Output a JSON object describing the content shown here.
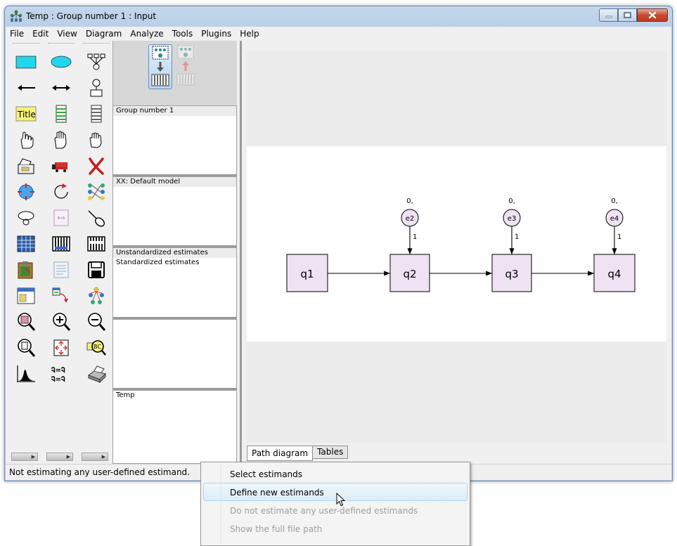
{
  "window": {
    "title": "Temp : Group number 1 : Input"
  },
  "menu": [
    "File",
    "Edit",
    "View",
    "Diagram",
    "Analyze",
    "Tools",
    "Plugins",
    "Help"
  ],
  "toolbox": {
    "tools": [
      "rectangle-tool",
      "ellipse-tool",
      "indicator-tool",
      "arrow-tool",
      "double-arrow-tool",
      "unique-variable-tool",
      "title-tool",
      "variable-list-tool",
      "dataset-variables-tool",
      "select-one-tool",
      "select-all-tool",
      "deselect-all-tool",
      "duplicate-tool",
      "move-tool",
      "erase-tool",
      "shape-tool",
      "rotate-tool",
      "reflect-tool",
      "move-parameter-tool",
      "scroll-tool",
      "touch-up-tool",
      "data-files-tool",
      "analysis-properties-tool",
      "calculate-estimates-tool",
      "copy-to-clipboard-tool",
      "view-text-tool",
      "save-tool",
      "object-properties-tool",
      "drag-properties-tool",
      "preserve-symmetries-tool",
      "zoom-area-tool",
      "zoom-in-tool",
      "zoom-out-tool",
      "zoom-page-tool",
      "fit-page-tool",
      "loupe-tool",
      "bayesian-tool",
      "multiple-group-tool",
      "print-tool"
    ]
  },
  "panels": {
    "groups": [
      "Group number 1"
    ],
    "models": [
      "XX: Default model"
    ],
    "estimates": [
      "Unstandardized estimates",
      "Standardized estimates"
    ],
    "file": [
      "Temp"
    ]
  },
  "diagram": {
    "observed": [
      "q1",
      "q2",
      "q3",
      "q4"
    ],
    "errors": [
      "e2",
      "e3",
      "e4"
    ],
    "error_labels": [
      "0,",
      "0,",
      "0,"
    ],
    "path_labels": [
      "1",
      "1",
      "1"
    ]
  },
  "tabs": {
    "path_diagram": "Path diagram",
    "tables": "Tables"
  },
  "status": "Not estimating any user-defined estimand.",
  "context_menu": {
    "items": [
      {
        "label": "Select estimands",
        "state": "normal"
      },
      {
        "label": "Define new estimands",
        "state": "hover"
      },
      {
        "label": "Do not estimate any user-defined estimands",
        "state": "disabled"
      },
      {
        "label": "Show the full file path",
        "state": "disabled"
      }
    ]
  },
  "colors": {
    "variable_fill": "#eee2f3",
    "titlebar": "#bcd0e8",
    "close_button": "#c74a2f",
    "menu_hover": "#dcedf9"
  }
}
